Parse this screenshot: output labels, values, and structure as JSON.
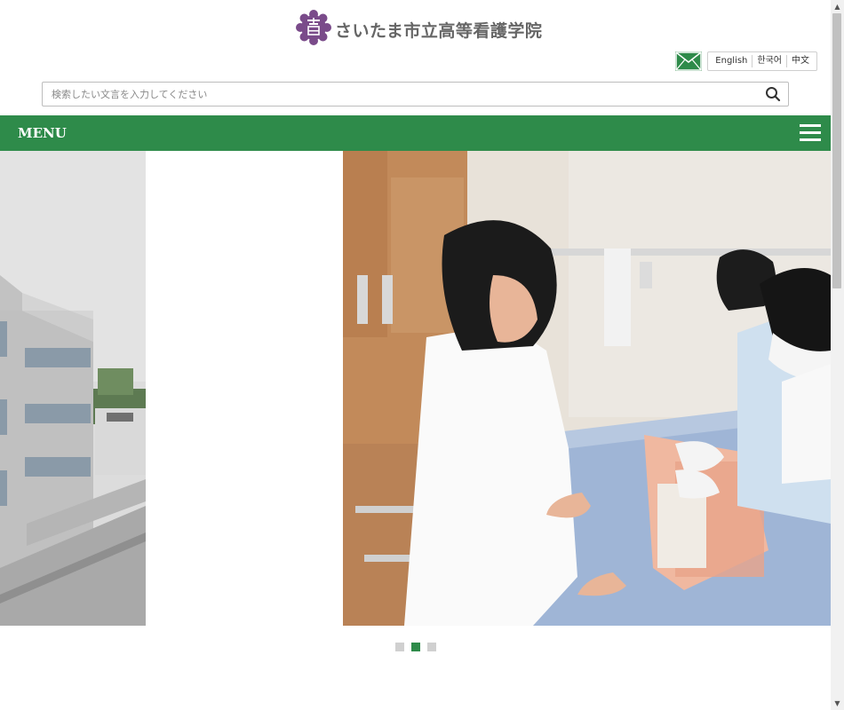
{
  "header": {
    "site_title": "さいたま市立高等看護学院",
    "languages": [
      "English",
      "한국어",
      "中文"
    ]
  },
  "search": {
    "placeholder": "検索したい文言を入力してください"
  },
  "nav": {
    "menu_label": "MENU"
  },
  "slider": {
    "slide_count": 3,
    "active_index": 1
  },
  "colors": {
    "brand_green": "#2e8b4a",
    "logo_purple": "#7a4b8a"
  }
}
